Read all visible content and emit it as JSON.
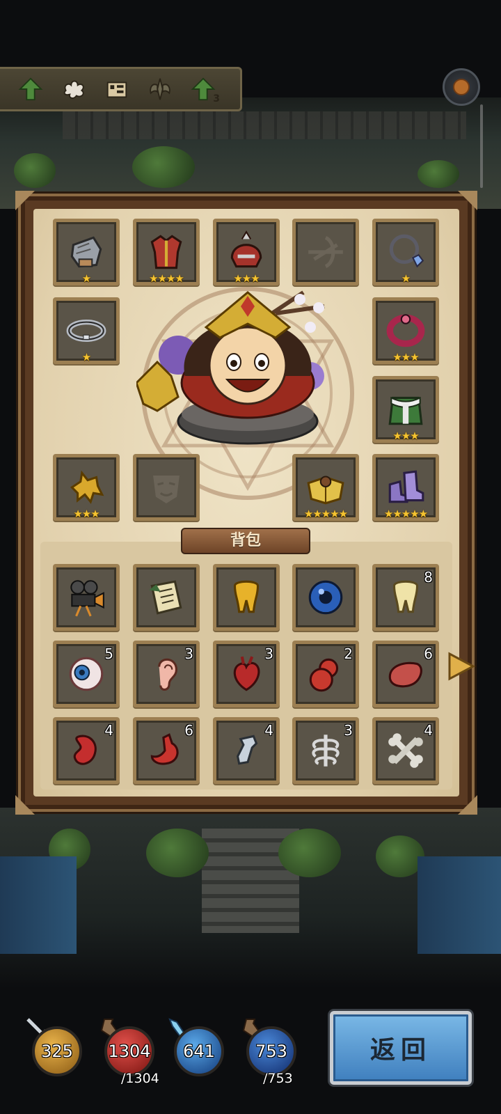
{
  "toolbar": {
    "items": [
      {
        "icon": "green-up-arrow-icon",
        "badge": ""
      },
      {
        "icon": "splat-icon",
        "badge": ""
      },
      {
        "icon": "film-map-icon",
        "badge": ""
      },
      {
        "icon": "winged-emblem-icon",
        "badge": ""
      },
      {
        "icon": "green-up-arrow-icon",
        "badge": "3"
      }
    ]
  },
  "equipment": {
    "gauntlet": {
      "stars": "★",
      "icon": "gauntlet-icon"
    },
    "armor": {
      "stars": "★★★★",
      "icon": "armor-icon"
    },
    "helmet": {
      "stars": "★★★",
      "icon": "helmet-icon"
    },
    "crossbow": {
      "stars": "",
      "icon": "crossbow-icon"
    },
    "necklace": {
      "stars": "★",
      "icon": "necklace-icon"
    },
    "ring_silver": {
      "stars": "★",
      "icon": "silver-ring-icon"
    },
    "ring_red": {
      "stars": "★★★",
      "icon": "red-ring-icon"
    },
    "cloak": {
      "stars": "★★★",
      "icon": "fur-cloak-icon"
    },
    "gold_beast": {
      "stars": "★★★",
      "icon": "gold-beast-icon"
    },
    "mask": {
      "stars": "",
      "icon": "mask-icon"
    },
    "book": {
      "stars": "★★★★★",
      "icon": "golden-book-icon"
    },
    "boots": {
      "stars": "★★★★★",
      "icon": "purple-boots-icon"
    }
  },
  "backpack": {
    "title": "背包",
    "items": [
      {
        "icon": "movie-camera-icon",
        "count": ""
      },
      {
        "icon": "scroll-icon",
        "count": ""
      },
      {
        "icon": "golden-tooth-icon",
        "count": ""
      },
      {
        "icon": "blue-orb-icon",
        "count": ""
      },
      {
        "icon": "tooth-icon",
        "count": "8"
      },
      {
        "icon": "eyeball-icon",
        "count": "5"
      },
      {
        "icon": "ear-icon",
        "count": "3"
      },
      {
        "icon": "heart-icon",
        "count": "3"
      },
      {
        "icon": "gourd-icon",
        "count": "2"
      },
      {
        "icon": "liver-icon",
        "count": "6"
      },
      {
        "icon": "kidney-icon",
        "count": "4"
      },
      {
        "icon": "stomach-icon",
        "count": "6"
      },
      {
        "icon": "bone-fragment-icon",
        "count": "4"
      },
      {
        "icon": "ribcage-icon",
        "count": "3"
      },
      {
        "icon": "bone-icon",
        "count": "4"
      }
    ]
  },
  "stats": {
    "attack": {
      "value": "325",
      "max": ""
    },
    "health": {
      "value": "1304",
      "max": "/1304"
    },
    "mana": {
      "value": "641",
      "max": ""
    },
    "energy": {
      "value": "753",
      "max": "/753"
    }
  },
  "return_label": "返回",
  "colors": {
    "star": "#f5c431",
    "button_blue": "#5a9ad4",
    "parchment": "#e8dabc"
  }
}
